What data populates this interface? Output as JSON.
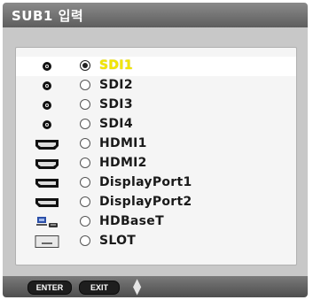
{
  "window": {
    "title": "SUB1 입력"
  },
  "colors": {
    "selected_text": "#f2e600",
    "title_bg": "#6e6e6e",
    "panel_bg": "#c8c8c8"
  },
  "inputs": [
    {
      "label": "SDI1",
      "icon": "sdi-connector-icon",
      "selected": true
    },
    {
      "label": "SDI2",
      "icon": "sdi-connector-icon",
      "selected": false
    },
    {
      "label": "SDI3",
      "icon": "sdi-connector-icon",
      "selected": false
    },
    {
      "label": "SDI4",
      "icon": "sdi-connector-icon",
      "selected": false
    },
    {
      "label": "HDMI1",
      "icon": "hdmi-connector-icon",
      "selected": false
    },
    {
      "label": "HDMI2",
      "icon": "hdmi-connector-icon",
      "selected": false
    },
    {
      "label": "DisplayPort1",
      "icon": "displayport-connector-icon",
      "selected": false
    },
    {
      "label": "DisplayPort2",
      "icon": "displayport-connector-icon",
      "selected": false
    },
    {
      "label": "HDBaseT",
      "icon": "hdbaset-network-icon",
      "selected": false
    },
    {
      "label": "SLOT",
      "icon": "option-slot-icon",
      "selected": false
    }
  ],
  "footer": {
    "enter_label": "ENTER",
    "exit_label": "EXIT",
    "updown_icon": "up-down-arrows-icon"
  }
}
